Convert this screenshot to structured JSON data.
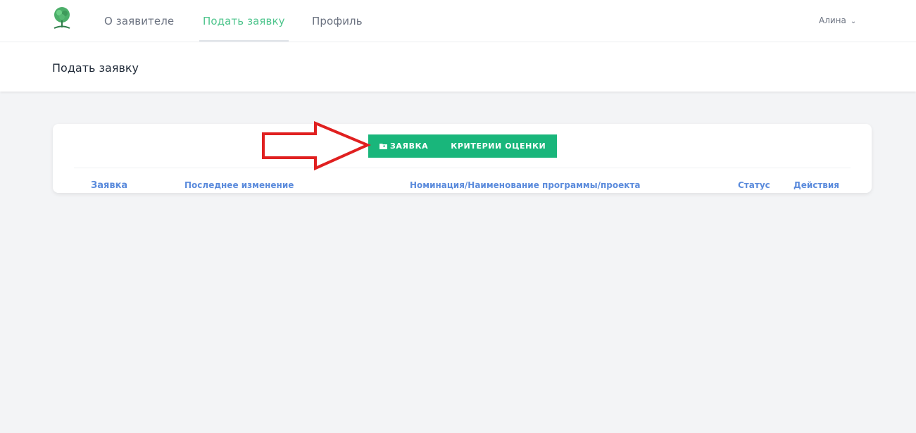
{
  "nav": {
    "links": [
      {
        "label": "О заявителе",
        "active": false
      },
      {
        "label": "Подать заявку",
        "active": true
      },
      {
        "label": "Профиль",
        "active": false
      }
    ],
    "user": {
      "name": "Алина",
      "chevron_icon": "chevron-down-icon"
    },
    "logo_icon": "tree-logo-icon"
  },
  "header": {
    "title": "Подать заявку"
  },
  "card": {
    "buttons": {
      "application": {
        "label": "ЗАЯВКА",
        "icon": "folder-icon"
      },
      "criteria": {
        "label": "КРИТЕРИИ ОЦЕНКИ"
      }
    },
    "table": {
      "columns": [
        "Заявка",
        "Последнее изменение",
        "Номинация/Наименование программы/проекта",
        "Статус",
        "Действия"
      ]
    }
  },
  "annotation": {
    "icon": "red-arrow-icon",
    "color": "#e02020"
  },
  "colors": {
    "accent": "#4fc58d",
    "button": "#19b67b",
    "header_text": "#5b8bdc",
    "background": "#f3f4f6"
  }
}
